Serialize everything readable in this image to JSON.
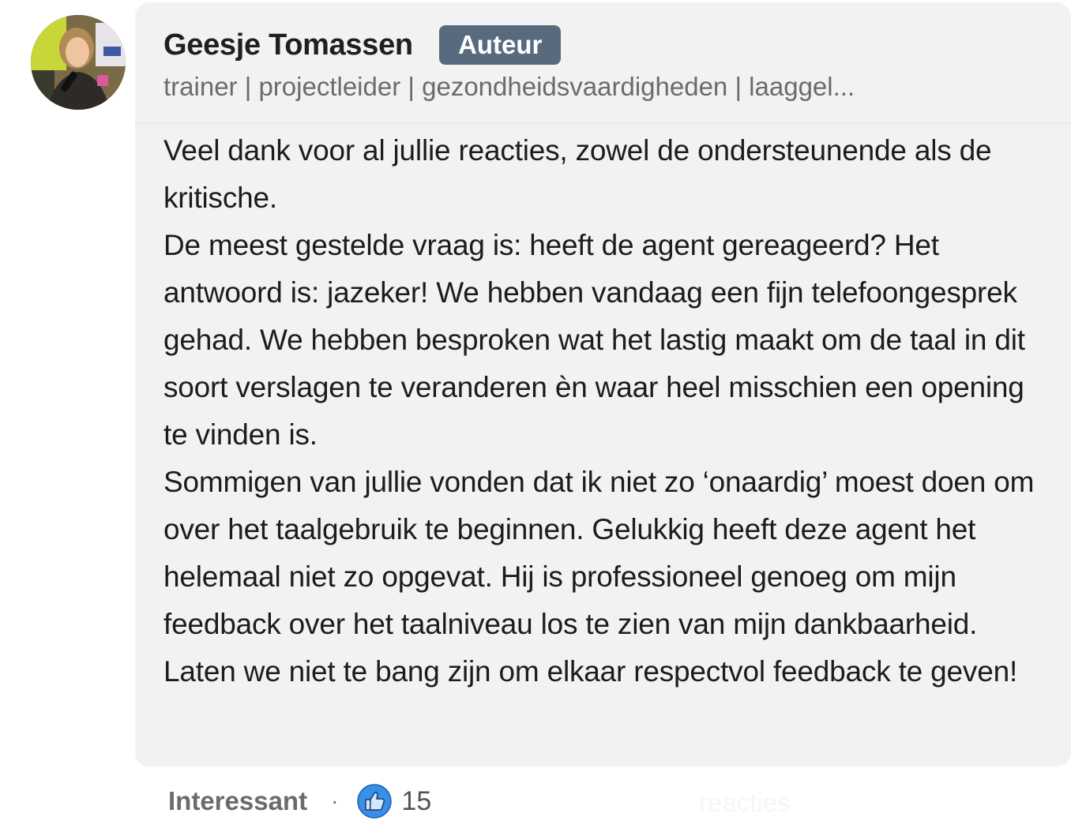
{
  "comment": {
    "author": {
      "name": "Geesje Tomassen",
      "badge": "Auteur",
      "headline": "trainer | projectleider | gezondheidsvaardigheden | laaggel..."
    },
    "paragraphs": [
      "Veel dank voor al jullie reacties, zowel de ondersteunende als de kritische.",
      "De meest gestelde vraag is: heeft de agent gereageerd? Het antwoord is: jazeker! We hebben vandaag een fijn telefoongesprek gehad. We hebben besproken wat het lastig maakt om de taal in dit soort verslagen te veranderen èn waar heel misschien een opening te vinden is.",
      "Sommigen van jullie vonden dat ik niet zo ‘onaardig’ moest doen om over het taalgebruik te beginnen. Gelukkig heeft deze agent het helemaal niet zo opgevat. Hij is professioneel genoeg om mijn feedback over het taalniveau los te zien van mijn dankbaarheid. Laten we niet te bang zijn om elkaar respectvol feedback te geven!"
    ]
  },
  "actions": {
    "react_label": "Interessant",
    "separator": "·",
    "reaction_icon": "like-thumbs-up-icon",
    "reaction_count": "15",
    "faded_label": "reacties"
  },
  "colors": {
    "card_background": "#f2f2f2",
    "badge_background": "#586a7e",
    "like_icon_blue": "#378fe9"
  }
}
